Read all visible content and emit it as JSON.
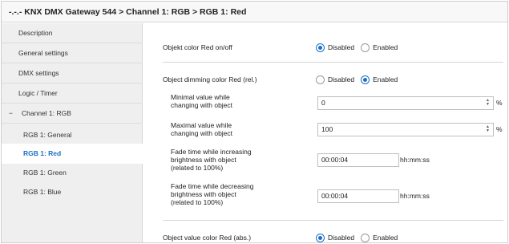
{
  "breadcrumb": "-.-.- KNX DMX Gateway 544 > Channel 1: RGB > RGB 1: Red",
  "sidebar": {
    "items": [
      {
        "label": "Description"
      },
      {
        "label": "General settings"
      },
      {
        "label": "DMX settings"
      },
      {
        "label": "Logic / Timer"
      },
      {
        "label": "Channel 1: RGB",
        "expanded": true
      },
      {
        "label": "RGB 1: General"
      },
      {
        "label": "RGB 1: Red",
        "selected": true
      },
      {
        "label": "RGB 1: Green"
      },
      {
        "label": "RGB 1: Blue"
      }
    ]
  },
  "params": {
    "objekt_color_red": {
      "label": "Objekt color Red on/off",
      "opt_disabled": "Disabled",
      "opt_enabled": "Enabled",
      "selected": "Disabled"
    },
    "object_dimming": {
      "label": "Object dimming color Red (rel.)",
      "opt_disabled": "Disabled",
      "opt_enabled": "Enabled",
      "selected": "Enabled"
    },
    "min_value": {
      "label_line1": "Minimal value while",
      "label_line2": "changing with object",
      "value": "0",
      "unit": "%"
    },
    "max_value": {
      "label_line1": "Maximal value while",
      "label_line2": "changing with object",
      "value": "100",
      "unit": "%"
    },
    "fade_increase": {
      "label_line1": "Fade time while increasing",
      "label_line2": "brightness with object",
      "label_line3": "(related to 100%)",
      "value": "00:00:04",
      "unit": "hh:mm:ss"
    },
    "fade_decrease": {
      "label_line1": "Fade time while decreasing",
      "label_line2": "brightness with object",
      "label_line3": "(related to 100%)",
      "value": "00:00:04",
      "unit": "hh:mm:ss"
    },
    "object_value_abs": {
      "label": "Object value color Red (abs.)",
      "opt_disabled": "Disabled",
      "opt_enabled": "Enabled",
      "selected": "Disabled"
    }
  },
  "colors": {
    "accent": "#1a6fc4",
    "sidebar_bg": "#efefef"
  }
}
